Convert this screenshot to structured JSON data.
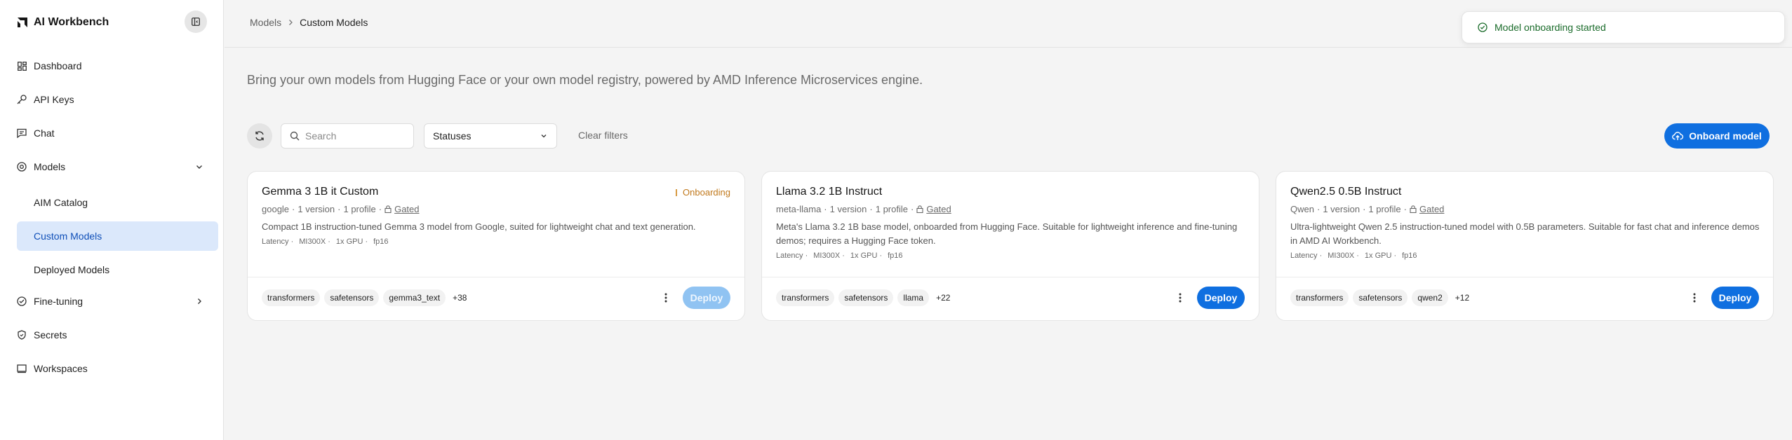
{
  "app": {
    "title": "AI Workbench"
  },
  "sidebar": {
    "items": [
      {
        "label": "Dashboard",
        "icon": "dashboard-icon"
      },
      {
        "label": "API Keys",
        "icon": "key-icon"
      },
      {
        "label": "Chat",
        "icon": "chat-icon"
      },
      {
        "label": "Models",
        "icon": "models-icon",
        "expanded": true,
        "children": [
          {
            "label": "AIM Catalog"
          },
          {
            "label": "Custom Models",
            "active": true
          },
          {
            "label": "Deployed Models"
          }
        ]
      },
      {
        "label": "Fine-tuning",
        "icon": "fine-tuning-icon"
      },
      {
        "label": "Secrets",
        "icon": "shield-icon"
      },
      {
        "label": "Workspaces",
        "icon": "workspace-icon"
      }
    ]
  },
  "breadcrumb": {
    "parent": "Models",
    "current": "Custom Models"
  },
  "intro": "Bring your own models from Hugging Face or your own model registry, powered by AMD Inference Microservices engine.",
  "toolbar": {
    "search_placeholder": "Search",
    "status_value": "Statuses",
    "clear_label": "Clear filters",
    "onboard_label": "Onboard model"
  },
  "toast": {
    "message": "Model onboarding started"
  },
  "cards": [
    {
      "title": "Gemma 3 1B it Custom",
      "status": "Onboarding",
      "owner": "google",
      "versions": "1 version",
      "profiles": "1 profile",
      "gated": "Gated",
      "description": "Compact 1B instruction-tuned Gemma 3 model from Google, suited for lightweight chat and text generation.",
      "specs": {
        "latency": "Latency ·",
        "gpu_model": "MI300X ·",
        "gpu_count": "1x GPU ·",
        "precision": "fp16"
      },
      "tags": [
        "transformers",
        "safetensors",
        "gemma3_text"
      ],
      "more_tags": "+38",
      "deploy_label": "Deploy",
      "deploy_disabled": true
    },
    {
      "title": "Llama 3.2 1B Instruct",
      "status": "",
      "owner": "meta-llama",
      "versions": "1 version",
      "profiles": "1 profile",
      "gated": "Gated",
      "description": "Meta's Llama 3.2 1B base model, onboarded from Hugging Face. Suitable for lightweight inference and fine-tuning demos; requires a Hugging Face token.",
      "specs": {
        "latency": "Latency ·",
        "gpu_model": "MI300X ·",
        "gpu_count": "1x GPU ·",
        "precision": "fp16"
      },
      "tags": [
        "transformers",
        "safetensors",
        "llama"
      ],
      "more_tags": "+22",
      "deploy_label": "Deploy",
      "deploy_disabled": false
    },
    {
      "title": "Qwen2.5 0.5B Instruct",
      "status": "",
      "owner": "Qwen",
      "versions": "1 version",
      "profiles": "1 profile",
      "gated": "Gated",
      "description": "Ultra-lightweight Qwen 2.5 instruction-tuned model with 0.5B parameters. Suitable for fast chat and inference demos in AMD AI Workbench.",
      "specs": {
        "latency": "Latency ·",
        "gpu_model": "MI300X ·",
        "gpu_count": "1x GPU ·",
        "precision": "fp16"
      },
      "tags": [
        "transformers",
        "safetensors",
        "qwen2"
      ],
      "more_tags": "+12",
      "deploy_label": "Deploy",
      "deploy_disabled": false
    }
  ],
  "colors": {
    "primary": "#0f6fe0",
    "primary_disabled": "#90c3f2",
    "active_nav_bg": "#dbe8fb",
    "onboarding": "#c0781b",
    "success": "#1a6b2a"
  }
}
